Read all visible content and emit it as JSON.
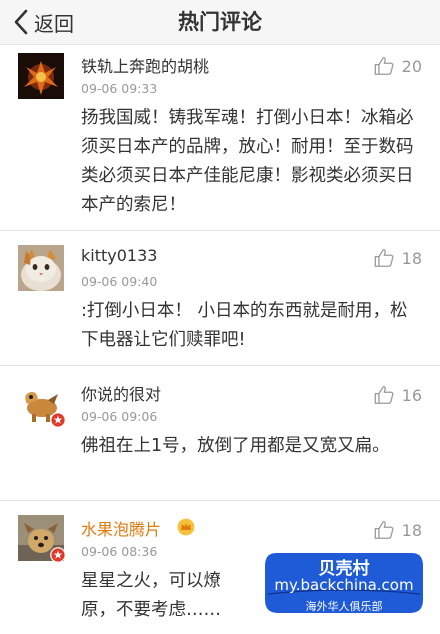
{
  "header": {
    "back_label": "返回",
    "title": "热门评论"
  },
  "comments": [
    {
      "username": "铁轨上奔跑的胡桃",
      "time": "09-06 09:33",
      "likes": "20",
      "text": "扬我国威！铸我军魂！打倒小日本！冰箱必须买日本产的品牌，放心！耐用！至于数码类必须买日本产佳能尼康！影视类必须买日本产的索尼！"
    },
    {
      "username": "kitty0133",
      "time": "09-06 09:40",
      "likes": "18",
      "text": ":打倒小日本！ 小日本的东西就是耐用，松下电器让它们赎罪吧!"
    },
    {
      "username": "你说的很对",
      "time": "09-06 09:06",
      "likes": "16",
      "text": "佛祖在上1号，放倒了用都是又宽又扁。"
    },
    {
      "username": "水果泡腾片",
      "time": "09-06 08:36",
      "likes": "18",
      "text": "星星之火，可以燎原，不要考虑……"
    }
  ],
  "watermark": {
    "name": "贝壳村",
    "url": "my.backchina.com",
    "subtitle": "海外华人俱乐部"
  },
  "colors": {
    "vip_name": "#e07b10",
    "watermark_bg": "#1f5bd6",
    "badge_red": "#e0392b"
  }
}
